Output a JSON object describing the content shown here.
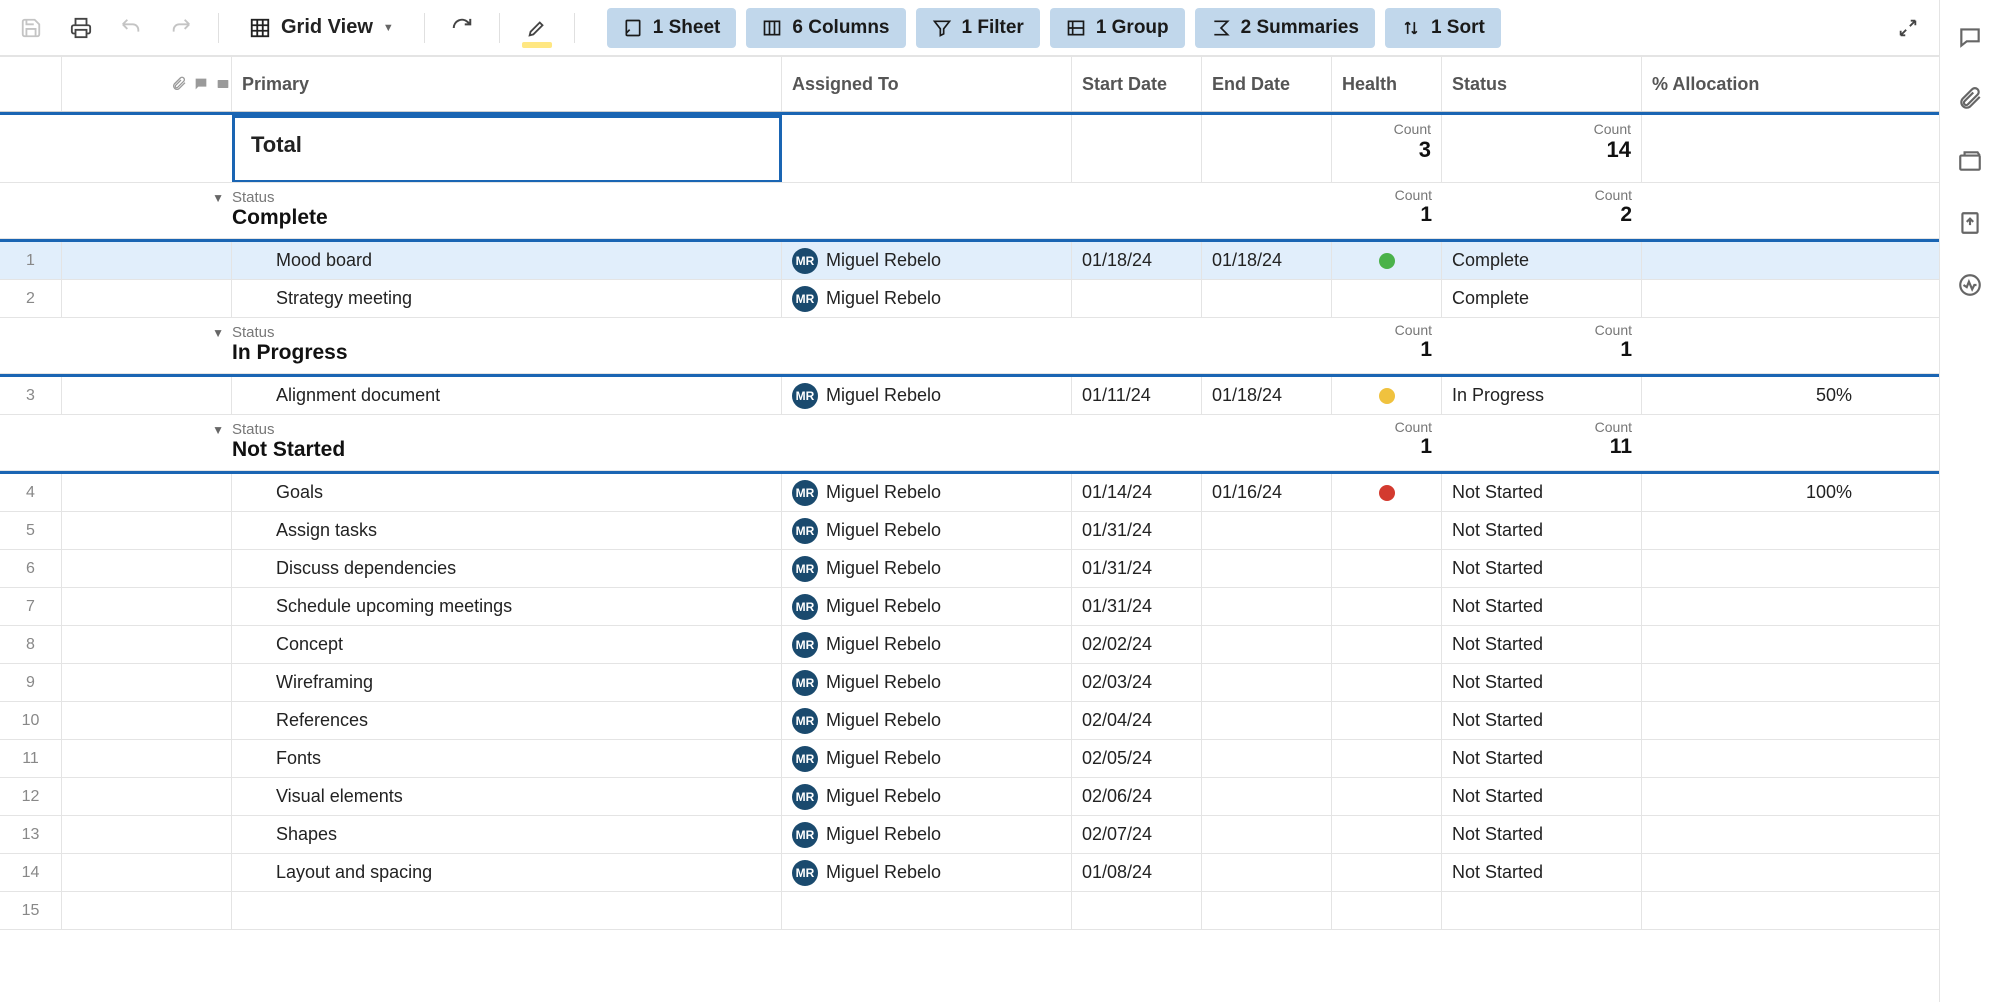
{
  "toolbar": {
    "view_label": "Grid View",
    "pills": {
      "sheet": "1 Sheet",
      "columns": "6 Columns",
      "filter": "1 Filter",
      "group": "1 Group",
      "summaries": "2 Summaries",
      "sort": "1 Sort"
    }
  },
  "columns": {
    "primary": "Primary",
    "assigned": "Assigned To",
    "start": "Start Date",
    "end": "End Date",
    "health": "Health",
    "status": "Status",
    "allocation": "% Allocation"
  },
  "assignee": {
    "initials": "MR",
    "name": "Miguel Rebelo"
  },
  "total": {
    "label": "Total",
    "count_label": "Count",
    "health_count": "3",
    "status_count": "14"
  },
  "groups": [
    {
      "status_label": "Status",
      "name": "Complete",
      "health_count": "1",
      "status_count": "2",
      "rows": [
        {
          "num": "1",
          "primary": "Mood board",
          "start": "01/18/24",
          "end": "01/18/24",
          "health": "green",
          "status": "Complete",
          "alloc": "",
          "selected": true
        },
        {
          "num": "2",
          "primary": "Strategy meeting",
          "start": "",
          "end": "",
          "health": "",
          "status": "Complete",
          "alloc": ""
        }
      ]
    },
    {
      "status_label": "Status",
      "name": "In Progress",
      "health_count": "1",
      "status_count": "1",
      "rows": [
        {
          "num": "3",
          "primary": "Alignment document",
          "start": "01/11/24",
          "end": "01/18/24",
          "health": "yellow",
          "status": "In Progress",
          "alloc": "50%"
        }
      ]
    },
    {
      "status_label": "Status",
      "name": "Not Started",
      "health_count": "1",
      "status_count": "11",
      "rows": [
        {
          "num": "4",
          "primary": "Goals",
          "start": "01/14/24",
          "end": "01/16/24",
          "health": "red",
          "status": "Not Started",
          "alloc": "100%"
        },
        {
          "num": "5",
          "primary": "Assign tasks",
          "start": "01/31/24",
          "end": "",
          "health": "",
          "status": "Not Started",
          "alloc": ""
        },
        {
          "num": "6",
          "primary": "Discuss dependencies",
          "start": "01/31/24",
          "end": "",
          "health": "",
          "status": "Not Started",
          "alloc": ""
        },
        {
          "num": "7",
          "primary": "Schedule upcoming meetings",
          "start": "01/31/24",
          "end": "",
          "health": "",
          "status": "Not Started",
          "alloc": ""
        },
        {
          "num": "8",
          "primary": "Concept",
          "start": "02/02/24",
          "end": "",
          "health": "",
          "status": "Not Started",
          "alloc": ""
        },
        {
          "num": "9",
          "primary": "Wireframing",
          "start": "02/03/24",
          "end": "",
          "health": "",
          "status": "Not Started",
          "alloc": ""
        },
        {
          "num": "10",
          "primary": "References",
          "start": "02/04/24",
          "end": "",
          "health": "",
          "status": "Not Started",
          "alloc": ""
        },
        {
          "num": "11",
          "primary": "Fonts",
          "start": "02/05/24",
          "end": "",
          "health": "",
          "status": "Not Started",
          "alloc": ""
        },
        {
          "num": "12",
          "primary": "Visual elements",
          "start": "02/06/24",
          "end": "",
          "health": "",
          "status": "Not Started",
          "alloc": ""
        },
        {
          "num": "13",
          "primary": "Shapes",
          "start": "02/07/24",
          "end": "",
          "health": "",
          "status": "Not Started",
          "alloc": ""
        },
        {
          "num": "14",
          "primary": "Layout and spacing",
          "start": "01/08/24",
          "end": "",
          "health": "",
          "status": "Not Started",
          "alloc": ""
        }
      ]
    }
  ],
  "empty_row": "15"
}
